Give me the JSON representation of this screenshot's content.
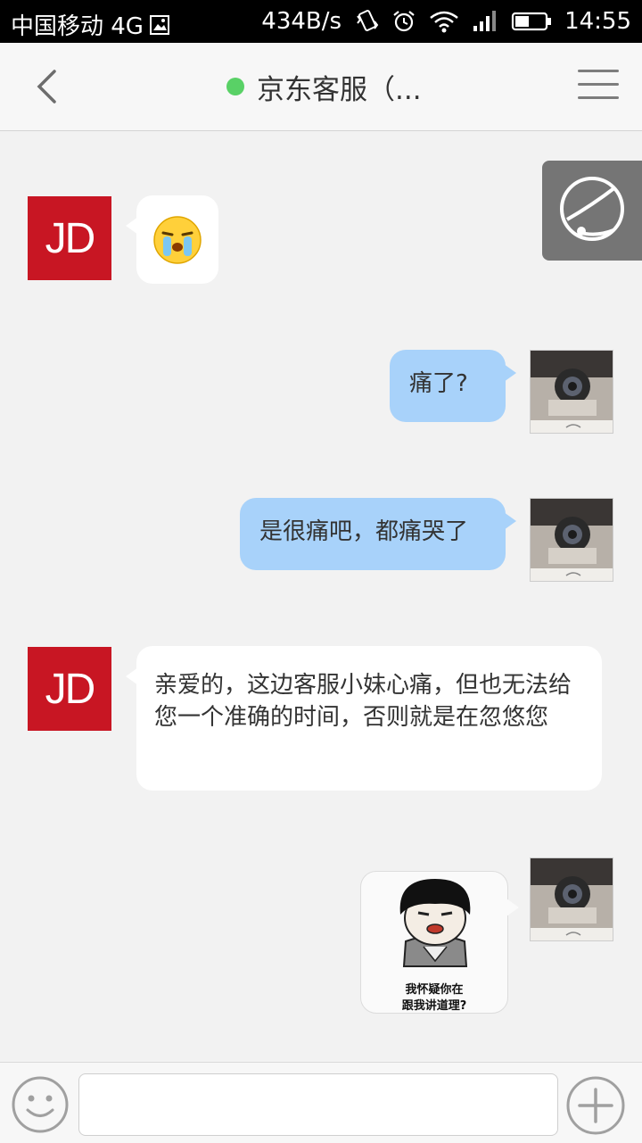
{
  "status_bar": {
    "carrier": "中国移动 4G",
    "speed": "434B/s",
    "time": "14:55",
    "icons": [
      "image-icon",
      "vibrate-icon",
      "alarm-icon",
      "wifi-icon",
      "signal-icon",
      "battery-icon"
    ]
  },
  "header": {
    "title": "京东客服（...",
    "online_color": "#59d166",
    "back_icon": "chevron-left-icon",
    "menu_icon": "menu-icon"
  },
  "floating": {
    "icon": "customer-service-headset-icon"
  },
  "messages": [
    {
      "side": "left",
      "sender": "jd",
      "avatar_text": "JD",
      "type": "emoji",
      "icon": "crying-face-emoji"
    },
    {
      "side": "right",
      "sender": "user",
      "type": "text",
      "text": "痛了?"
    },
    {
      "side": "right",
      "sender": "user",
      "type": "text",
      "text": "是很痛吧，都痛哭了"
    },
    {
      "side": "left",
      "sender": "jd",
      "avatar_text": "JD",
      "type": "text",
      "text": "亲爱的，这边客服小妹心痛，但也无法给您一个准确的时间，否则就是在忽悠您"
    },
    {
      "side": "right",
      "sender": "user",
      "type": "sticker",
      "caption_line1": "我怀疑你在",
      "caption_line2": "跟我讲道理?"
    }
  ],
  "input_bar": {
    "emoji_icon": "smiley-icon",
    "placeholder": "",
    "value": "",
    "plus_icon": "plus-icon"
  },
  "colors": {
    "jd_red": "#c81623",
    "user_bubble": "#a8d2fa",
    "background": "#f2f2f2"
  }
}
